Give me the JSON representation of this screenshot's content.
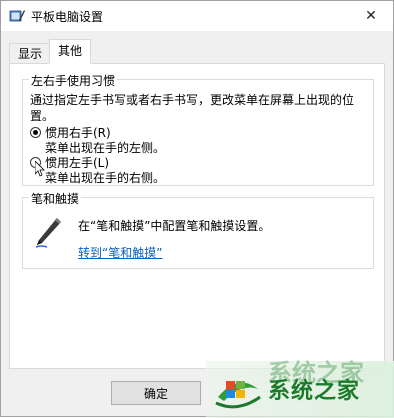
{
  "window": {
    "title": "平板电脑设置",
    "close_symbol": "✕"
  },
  "tabs": [
    {
      "label": "显示",
      "active": false
    },
    {
      "label": "其他",
      "active": true
    }
  ],
  "handedness": {
    "title": "左右手使用习惯",
    "description": "通过指定左手书写或者右手书写，更改菜单在屏幕上出现的位置。",
    "options": [
      {
        "label": "惯用右手(R)",
        "sub": "菜单出现在手的左侧。",
        "checked": true
      },
      {
        "label": "惯用左手(L)",
        "sub": "菜单出现在手的右侧。",
        "checked": false
      }
    ]
  },
  "pen": {
    "title": "笔和触摸",
    "icon": "pen-icon",
    "description": "在“笔和触摸”中配置笔和触摸设置。",
    "link": "转到“笔和触摸”"
  },
  "buttons": {
    "ok": "确定"
  },
  "watermark": {
    "text": "系统之家",
    "ghost_text": "系统之家",
    "color": "#1a7a2a"
  }
}
